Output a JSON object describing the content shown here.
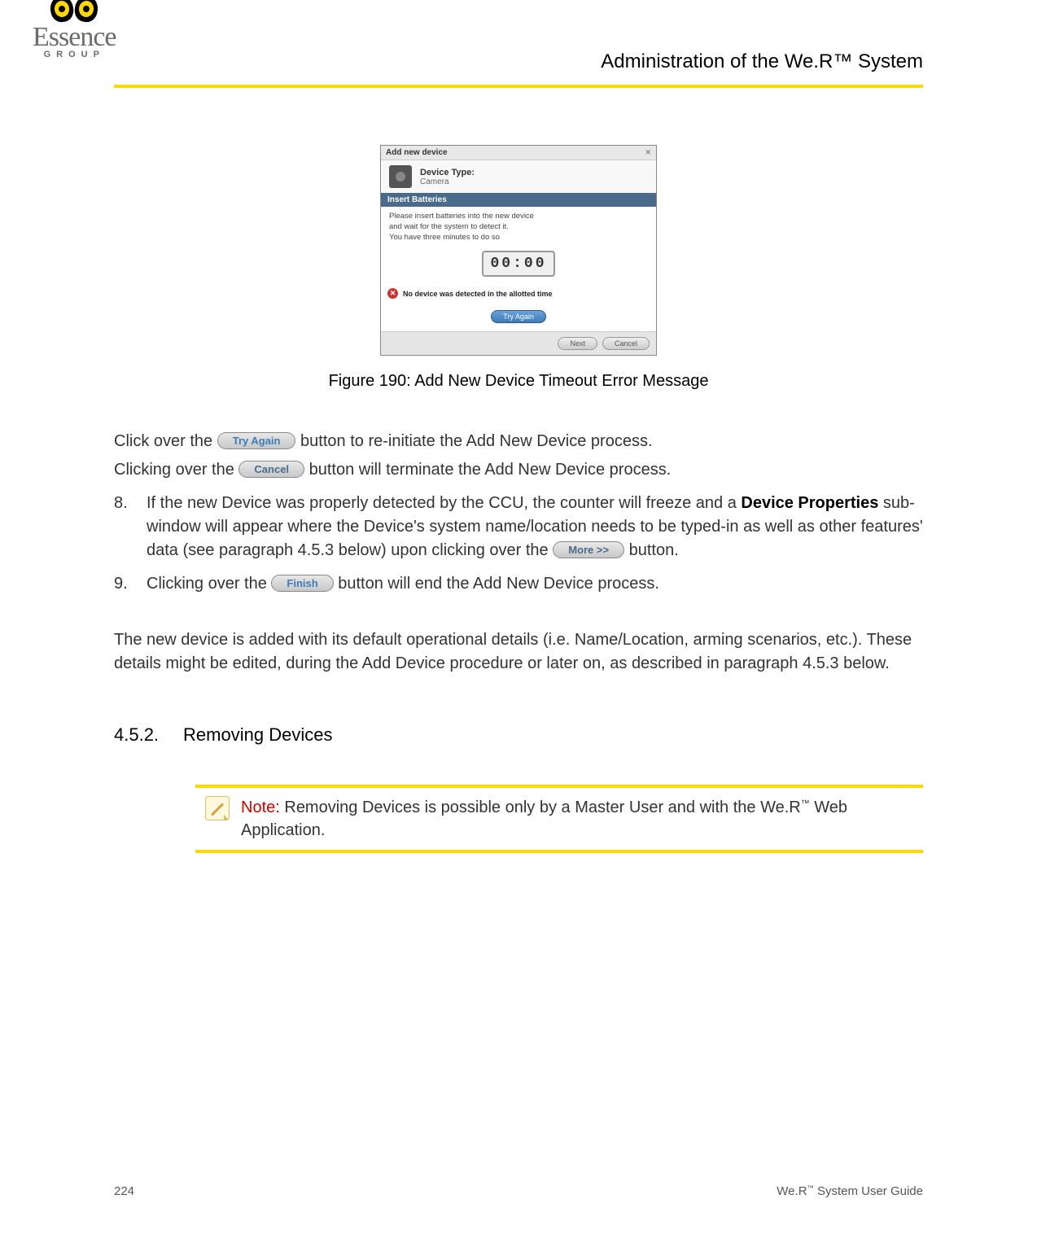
{
  "logo": {
    "name": "Essence",
    "sub": "GROUP"
  },
  "header_title": "Administration of the We.R™ System",
  "figure": {
    "titlebar": "Add new device",
    "device_label": "Device Type:",
    "device_value": "Camera",
    "blue_bar": "Insert Batteries",
    "instr_l1": "Please insert batteries into the new device",
    "instr_l2": "and wait for the system to detect it.",
    "instr_l3": "You have three minutes to do so",
    "counter": "00:00",
    "error": "No device was detected in the allotted time",
    "try_again": "Try Again",
    "next": "Next",
    "cancel": "Cancel"
  },
  "figure_caption": "Figure 190: Add New Device Timeout Error Message",
  "p_click_over": "Click over the ",
  "p_click_over_after": " button to re-initiate the Add New Device process.",
  "p_clicking_over": "Clicking over the ",
  "p_clicking_over_after": " button will terminate the Add New Device process.",
  "btn_try_again": "Try Again",
  "btn_cancel": "Cancel",
  "btn_more": "More >>",
  "btn_finish": "Finish",
  "item8_num": "8.",
  "item8_a": "If the new Device was properly detected by the CCU, the counter will freeze and a ",
  "item8_bold": "Device Properties",
  "item8_b": " sub-window will appear where the Device's system name/location needs to be typed-in as well as other features' data (see paragraph 4.5.3 below) upon clicking over the ",
  "item8_c": " button.",
  "item9_num": "9.",
  "item9_a": "Clicking over the ",
  "item9_b": " button will end the Add New Device process.",
  "para_default": "The new device is added with its default operational details (i.e. Name/Location, arming scenarios, etc.). These details might be edited, during the Add Device procedure or later on, as described in paragraph 4.5.3 below.",
  "section_num": "4.5.2.",
  "section_title": "Removing Devices",
  "note_label": "Note:",
  "note_text_a": " Removing Devices is possible only by a Master User and with the We.R",
  "note_text_b": " Web Application.",
  "footer_page": "224",
  "footer_guide_a": "We.R",
  "footer_guide_b": " System User Guide",
  "tm": "™"
}
